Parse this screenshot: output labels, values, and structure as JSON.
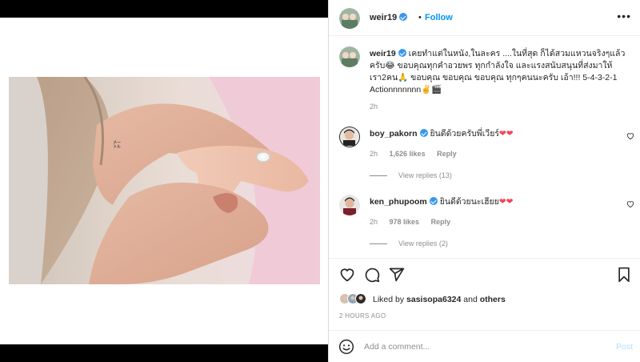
{
  "post": {
    "username": "weir19",
    "dot": "•",
    "follow_label": "Follow",
    "more_label": "•••"
  },
  "caption": {
    "username": "weir19",
    "text": "เคยทำแต่ในหนัง,ในละคร ....ในที่สุด ก็ได้สวมแหวนจริงๆแล้วครับ😂 ขอบคุณทุกคำอวยพร ทุกกำลังใจ และแรงสนับสนุนที่ส่งมาให้เรา2คน🙏 ขอบคุณ ขอบคุณ ขอบคุณ ทุกๆคนนะครับ เอ้า!!! 5-4-3-2-1 Actionnnnnnn✌️🎬",
    "time": "2h"
  },
  "comments": [
    {
      "username": "boy_pakorn",
      "text": "ยินดีด้วยครับพี่เวียร์",
      "hearts": "❤❤",
      "time": "2h",
      "likes": "1,626 likes",
      "reply_label": "Reply",
      "view_replies": "View replies (13)"
    },
    {
      "username": "ken_phupoom",
      "text": "ยินดีด้วยนะเฮียย",
      "hearts": "❤❤",
      "time": "2h",
      "likes": "978 likes",
      "reply_label": "Reply",
      "view_replies": "View replies (2)"
    }
  ],
  "likes": {
    "prefix": "Liked by",
    "user": "sasisopa6324",
    "and": "and",
    "others": "others"
  },
  "posted_time": "2 HOURS AGO",
  "composer": {
    "placeholder": "Add a comment...",
    "post_label": "Post"
  },
  "icons": {
    "like": "heart-icon",
    "comment": "comment-icon",
    "share": "share-icon",
    "save": "bookmark-icon",
    "emoji": "emoji-icon"
  },
  "colors": {
    "accent": "#0095f6",
    "verified": "#3897f0",
    "heart": "#ed4956",
    "muted": "#8e8e8e"
  }
}
